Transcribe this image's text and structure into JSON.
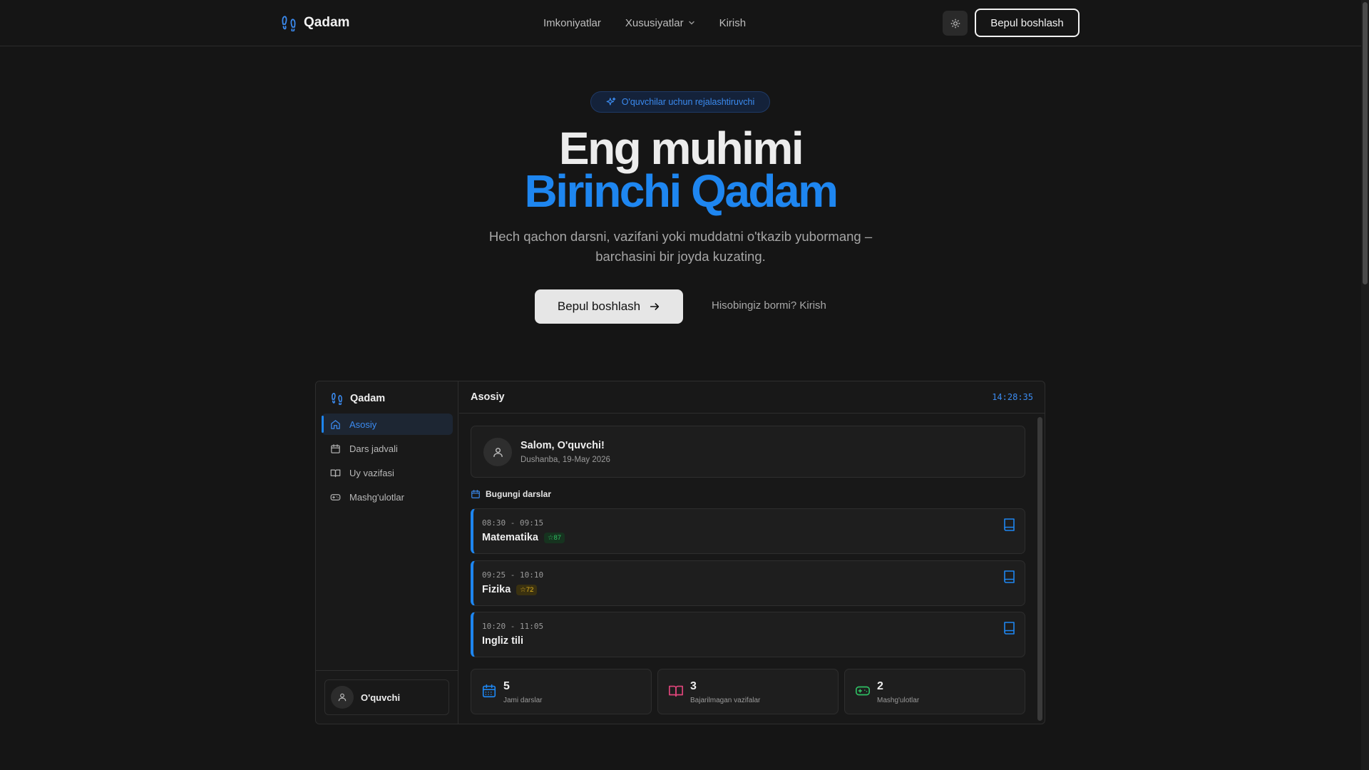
{
  "nav": {
    "brand": "Qadam",
    "links": {
      "features": "Imkoniyatlar",
      "specs": "Xususiyatlar",
      "login": "Kirish"
    },
    "cta": "Bepul boshlash"
  },
  "hero": {
    "badge": "O'quvchilar uchun rejalashtiruvchi",
    "title_line1": "Eng muhimi",
    "title_line2": "Birinchi Qadam",
    "subtitle": "Hech qachon darsni, vazifani yoki muddatni o'tkazib yubormang – barchasini bir joyda kuzating.",
    "cta": "Bepul boshlash",
    "login_prompt": "Hisobingiz bormi? Kirish"
  },
  "app": {
    "brand": "Qadam",
    "menu": [
      {
        "label": "Asosiy"
      },
      {
        "label": "Dars jadvali"
      },
      {
        "label": "Uy vazifasi"
      },
      {
        "label": "Mashg'ulotlar"
      }
    ],
    "user": "O'quvchi",
    "header_title": "Asosiy",
    "clock": "14:28:35",
    "greeting": "Salom, O'quvchi!",
    "date": "Dushanba, 19-May 2026",
    "section": "Bugungi darslar",
    "lessons": [
      {
        "time": "08:30 - 09:15",
        "subject": "Matematika",
        "score": "☆87"
      },
      {
        "time": "09:25 - 10:10",
        "subject": "Fizika",
        "score": "☆72"
      },
      {
        "time": "10:20 - 11:05",
        "subject": "Ingliz tili"
      }
    ],
    "stats": [
      {
        "value": "5",
        "label": "Jami darslar"
      },
      {
        "value": "3",
        "label": "Bajarilmagan vazifalar"
      },
      {
        "value": "2",
        "label": "Mashg'ulotlar"
      }
    ]
  },
  "colors": {
    "accent": "#1e86f0",
    "background": "#151515",
    "pink": "#e0457b",
    "green": "#2fbf63",
    "yellow": "#e2b320"
  }
}
